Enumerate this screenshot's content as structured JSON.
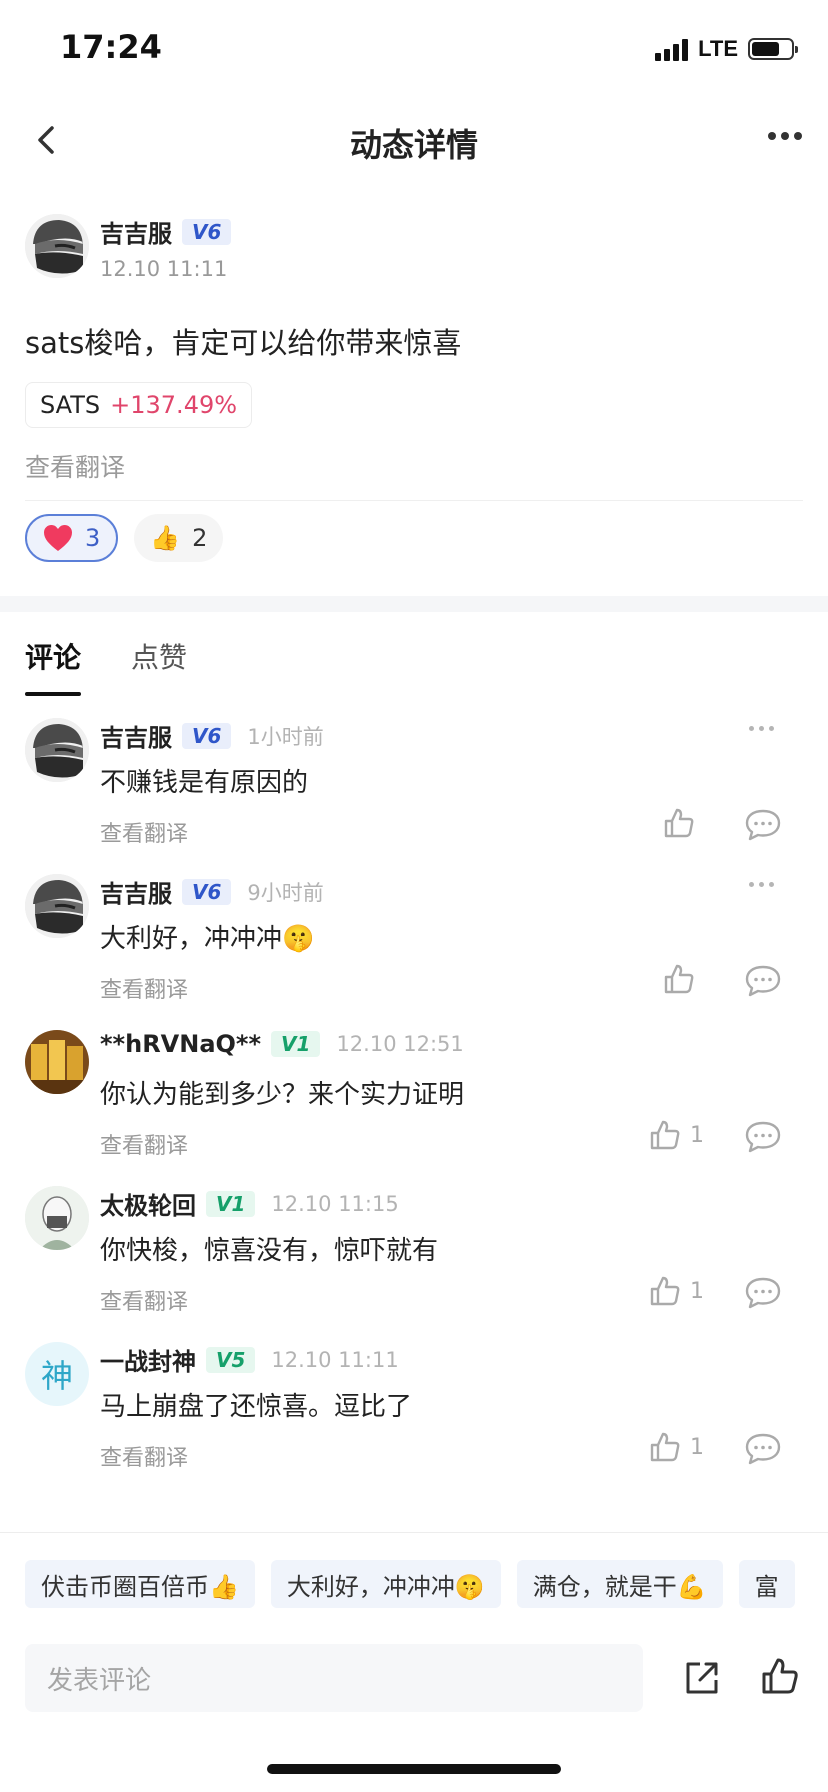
{
  "status_bar": {
    "time": "17:24",
    "network": "LTE",
    "battery_level": 0.7
  },
  "nav": {
    "title": "动态详情",
    "back_icon": "chevron-left-icon",
    "more_icon": "more-icon"
  },
  "post": {
    "author": "吉吉服",
    "level": "V6",
    "time": "12.10 11:11",
    "text": "sats梭哈，肯定可以给你带来惊喜",
    "ticker": {
      "symbol": "SATS",
      "change": "+137.49%"
    },
    "translate_label": "查看翻译",
    "reactions": [
      {
        "icon": "heart-icon",
        "count": "3",
        "selected": true
      },
      {
        "icon": "thumbs-up-emoji-icon",
        "count": "2",
        "selected": false
      }
    ]
  },
  "tabs": [
    {
      "label": "评论",
      "active": true
    },
    {
      "label": "点赞",
      "active": false
    }
  ],
  "comments": [
    {
      "author": "吉吉服",
      "level": "V6",
      "level_color": "blue",
      "time": "1小时前",
      "text": "不赚钱是有原因的",
      "translate_label": "查看翻译",
      "likes": "",
      "has_more": true,
      "avatar": "ninja"
    },
    {
      "author": "吉吉服",
      "level": "V6",
      "level_color": "blue",
      "time": "9小时前",
      "text": "大利好，冲冲冲🤫",
      "translate_label": "查看翻译",
      "likes": "",
      "has_more": true,
      "avatar": "ninja"
    },
    {
      "author": "**hRVNaQ**",
      "level": "V1",
      "level_color": "green",
      "time": "12.10 12:51",
      "text": "你认为能到多少？来个实力证明",
      "translate_label": "查看翻译",
      "likes": "1",
      "has_more": false,
      "avatar": "gold"
    },
    {
      "author": "太极轮回",
      "level": "V1",
      "level_color": "green",
      "time": "12.10 11:15",
      "text": "你快梭，惊喜没有，惊吓就有",
      "translate_label": "查看翻译",
      "likes": "1",
      "has_more": false,
      "avatar": "sketch"
    },
    {
      "author": "一战封神",
      "level": "V5",
      "level_color": "green",
      "time": "12.10 11:11",
      "text": "马上崩盘了还惊喜。逗比了",
      "translate_label": "查看翻译",
      "likes": "1",
      "has_more": false,
      "avatar": "letter",
      "avatar_letter": "神"
    }
  ],
  "quick_replies": [
    "伏击币圈百倍币👍",
    "大利好，冲冲冲🤫",
    "满仓，就是干💪",
    "富"
  ],
  "composer": {
    "placeholder": "发表评论",
    "share_icon": "share-icon",
    "like_icon": "thumbs-up-icon"
  },
  "colors": {
    "accent_blue": "#2f56c9",
    "level_green": "#16a06a",
    "rise_red": "#e0456b",
    "tab_underline": "#111111"
  }
}
